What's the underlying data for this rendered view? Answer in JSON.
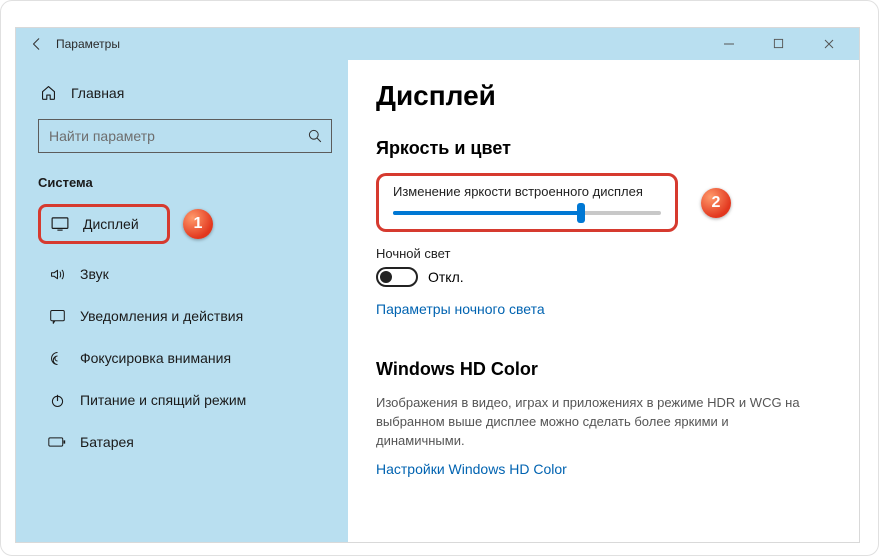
{
  "titlebar": {
    "back_aria": "Назад",
    "title": "Параметры"
  },
  "sidebar": {
    "home_label": "Главная",
    "search_placeholder": "Найти параметр",
    "section_label": "Система",
    "items": [
      {
        "label": "Дисплей"
      },
      {
        "label": "Звук"
      },
      {
        "label": "Уведомления и действия"
      },
      {
        "label": "Фокусировка внимания"
      },
      {
        "label": "Питание и спящий режим"
      },
      {
        "label": "Батарея"
      }
    ]
  },
  "main": {
    "heading": "Дисплей",
    "brightness_section": "Яркость и цвет",
    "brightness_label": "Изменение яркости встроенного дисплея",
    "brightness_percent": 70,
    "night_light_label": "Ночной свет",
    "night_light_state": "Откл.",
    "night_light_link": "Параметры ночного света",
    "hd_heading": "Windows HD Color",
    "hd_desc": "Изображения в видео, играх и приложениях в режиме HDR и WCG на выбранном выше дисплее можно сделать более яркими и динамичными.",
    "hd_link": "Настройки Windows HD Color"
  },
  "annotations": {
    "badge1": "1",
    "badge2": "2"
  }
}
